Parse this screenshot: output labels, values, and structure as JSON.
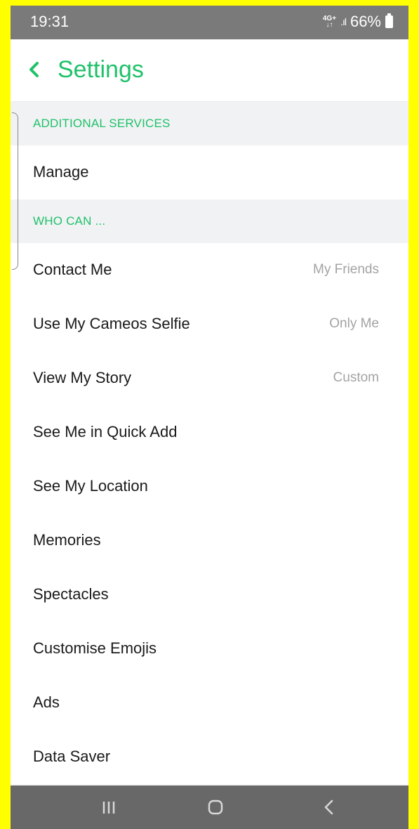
{
  "status_bar": {
    "time": "19:31",
    "network_top": "4G+",
    "network_bottom": "↓↑",
    "signal": ".ıl",
    "battery": "66%"
  },
  "header": {
    "back_icon": "chevron-left-icon",
    "title": "Settings"
  },
  "sections": {
    "additional_services": "ADDITIONAL SERVICES",
    "who_can": "WHO CAN ..."
  },
  "rows": [
    {
      "label": "Manage",
      "value": ""
    },
    {
      "label": "Contact Me",
      "value": "My Friends"
    },
    {
      "label": "Use My Cameos Selfie",
      "value": "Only Me"
    },
    {
      "label": "View My Story",
      "value": "Custom"
    },
    {
      "label": "See Me in Quick Add",
      "value": ""
    },
    {
      "label": "See My Location",
      "value": ""
    },
    {
      "label": "Memories",
      "value": ""
    },
    {
      "label": "Spectacles",
      "value": ""
    },
    {
      "label": "Customise Emojis",
      "value": ""
    },
    {
      "label": "Ads",
      "value": ""
    },
    {
      "label": "Data Saver",
      "value": ""
    }
  ],
  "nav_bar": {
    "recent_icon": "recent-apps-icon",
    "home_icon": "home-icon",
    "back_icon": "back-icon"
  },
  "colors": {
    "accent": "#1fc16a",
    "border": "#ffff00",
    "status_bar": "#7a7a7a",
    "nav_bar": "#686868"
  }
}
